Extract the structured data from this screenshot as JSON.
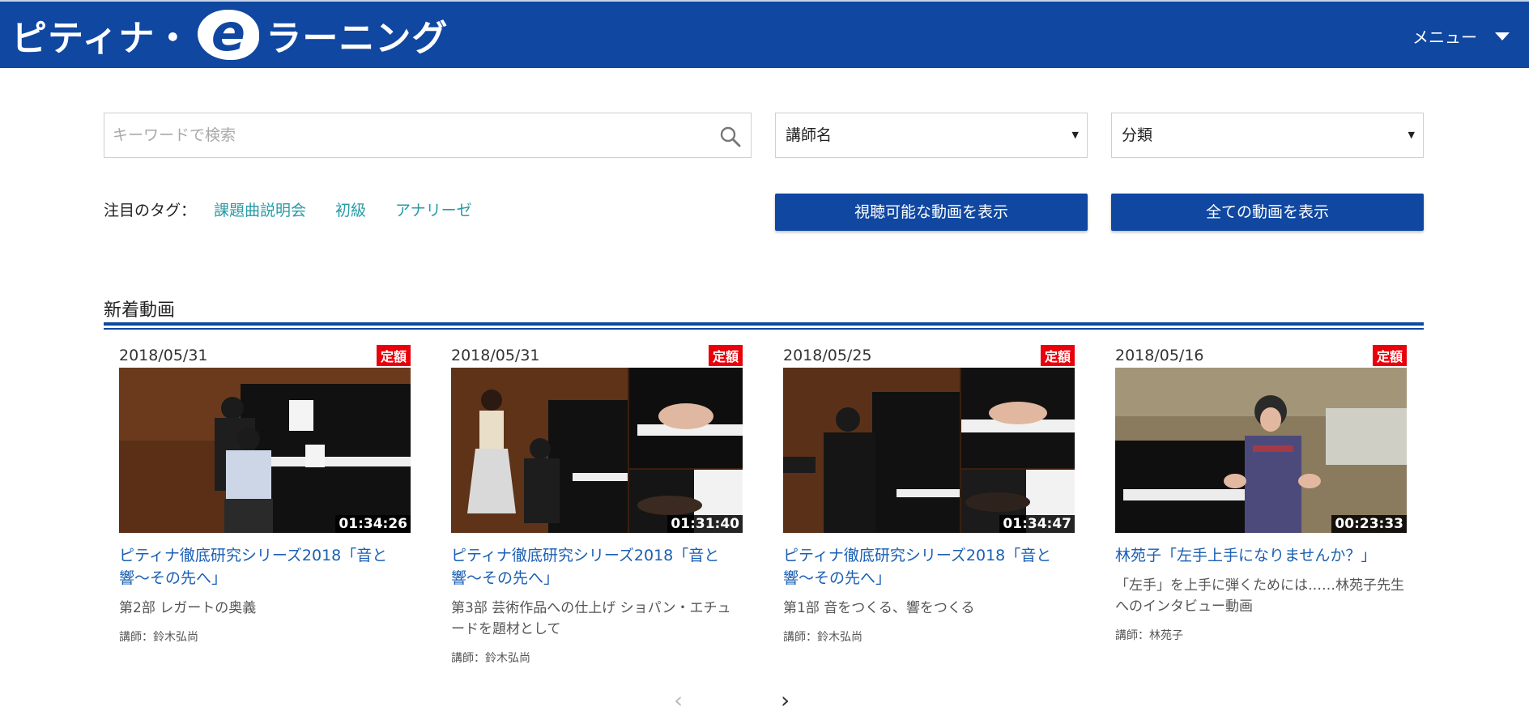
{
  "header": {
    "logo_pre": "ピティナ・",
    "logo_e": "e",
    "logo_post": "ラーニング",
    "menu_label": "メニュー"
  },
  "search": {
    "placeholder": "キーワードで検索"
  },
  "filters": {
    "teacher": "講師名",
    "category": "分類"
  },
  "tags": {
    "label": "注目のタグ：",
    "items": [
      "課題曲説明会",
      "初級",
      "アナリーゼ"
    ]
  },
  "buttons": {
    "show_viewable": "視聴可能な動画を表示",
    "show_all": "全ての動画を表示"
  },
  "section": {
    "title": "新着動画"
  },
  "videos": [
    {
      "date": "2018/05/31",
      "badge": "定額",
      "duration": "01:34:26",
      "title": "ピティナ徹底研究シリーズ2018「音と響〜その先へ」",
      "desc": "第2部 レガートの奥義",
      "teacher": "講師：鈴木弘尚"
    },
    {
      "date": "2018/05/31",
      "badge": "定額",
      "duration": "01:31:40",
      "title": "ピティナ徹底研究シリーズ2018「音と響〜その先へ」",
      "desc": "第3部 芸術作品への仕上げ ショパン・エチュードを題材として",
      "teacher": "講師：鈴木弘尚"
    },
    {
      "date": "2018/05/25",
      "badge": "定額",
      "duration": "01:34:47",
      "title": "ピティナ徹底研究シリーズ2018「音と響〜その先へ」",
      "desc": "第1部 音をつくる、響をつくる",
      "teacher": "講師：鈴木弘尚"
    },
    {
      "date": "2018/05/16",
      "badge": "定額",
      "duration": "00:23:33",
      "title": "林苑子「左手上手になりませんか？」",
      "desc": "「左手」を上手に弾くためには……林苑子先生へのインタビュー動画",
      "teacher": "講師：林苑子"
    }
  ],
  "pager": {
    "prev": "‹",
    "next": "›"
  },
  "colors": {
    "brand_blue": "#0f47a1",
    "badge_red": "#e8000b",
    "tag_teal": "#2a9aa6",
    "link_blue": "#1a5fb4"
  }
}
